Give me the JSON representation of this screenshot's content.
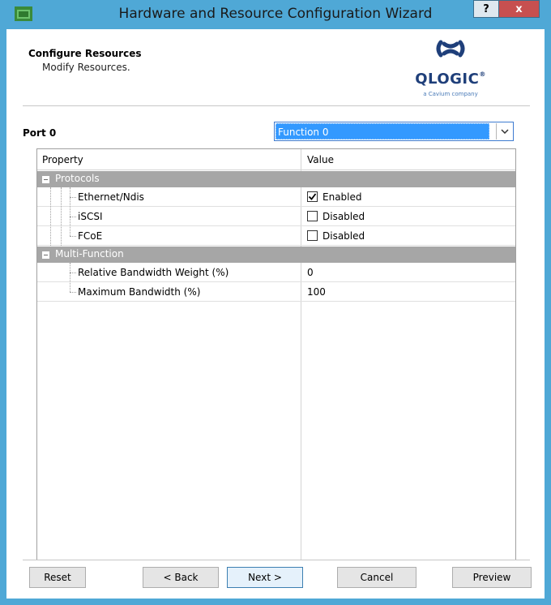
{
  "window": {
    "title": "Hardware and Resource Configuration Wizard",
    "help_label": "?",
    "close_label": "x"
  },
  "header": {
    "title": "Configure Resources",
    "subtitle": "Modify Resources.",
    "logo_text": "QLOGIC",
    "logo_reg": "®",
    "logo_sub": "a Cavium company"
  },
  "port": {
    "label": "Port 0",
    "function_selected": "Function 0"
  },
  "grid": {
    "col_property": "Property",
    "col_value": "Value",
    "categories": [
      {
        "name": "Protocols",
        "rows": [
          {
            "name": "Ethernet/Ndis",
            "checked": true,
            "value": "Enabled"
          },
          {
            "name": "iSCSI",
            "checked": false,
            "value": "Disabled"
          },
          {
            "name": "FCoE",
            "checked": false,
            "value": "Disabled"
          }
        ]
      },
      {
        "name": "Multi-Function",
        "rows": [
          {
            "name": "Relative Bandwidth Weight (%)",
            "value": "0"
          },
          {
            "name": "Maximum Bandwidth (%)",
            "value": "100"
          }
        ]
      }
    ]
  },
  "buttons": {
    "reset": "Reset",
    "back": "< Back",
    "next": "Next >",
    "cancel": "Cancel",
    "preview": "Preview"
  },
  "colors": {
    "titlebar": "#4fa8d6",
    "close": "#c75050",
    "selection": "#3399ff",
    "category": "#a6a6a6",
    "logo": "#1f3f7a"
  }
}
